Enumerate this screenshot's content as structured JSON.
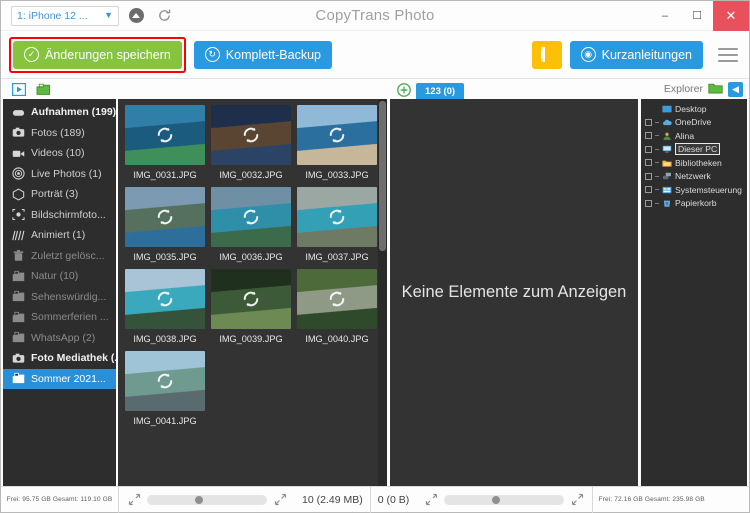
{
  "titlebar": {
    "device_label": "1: iPhone 12 ...",
    "chevron": "⌄",
    "eject_icon": "eject-icon",
    "refresh_icon": "refresh-icon",
    "app_title": "CopyTrans Photo",
    "minimize": "–",
    "maximize": "☐",
    "close": "✕"
  },
  "toolbar": {
    "save_label": "Änderungen speichern",
    "backup_label": "Komplett-Backup",
    "tips_label": "Kurzanleitungen",
    "bulb_icon": "lightbulb-icon",
    "menu_icon": "hamburger-menu-icon",
    "accent_green": "#86c440",
    "accent_blue": "#2a9ae0",
    "accent_yellow": "#fcc006",
    "highlight_red": "#ff0000"
  },
  "sidebar": {
    "tab_video_icon": "video-tab-icon",
    "tab_album_icon": "album-tab-icon",
    "items": [
      {
        "label": "Aufnahmen (199)",
        "icon": "camera-roll-icon",
        "style": "bold"
      },
      {
        "label": "Fotos (189)",
        "icon": "camera-icon",
        "style": "normal"
      },
      {
        "label": "Videos (10)",
        "icon": "video-icon",
        "style": "normal"
      },
      {
        "label": "Live Photos (1)",
        "icon": "live-photo-icon",
        "style": "normal"
      },
      {
        "label": "Porträt (3)",
        "icon": "portrait-icon",
        "style": "normal"
      },
      {
        "label": "Bildschirmfoto...",
        "icon": "screenshot-icon",
        "style": "normal"
      },
      {
        "label": "Animiert (1)",
        "icon": "animated-icon",
        "style": "normal"
      },
      {
        "label": "Zuletzt gelösc...",
        "icon": "trash-icon",
        "style": "dim"
      },
      {
        "label": "Natur (10)",
        "icon": "album-icon",
        "style": "dim"
      },
      {
        "label": "Sehenswürdig...",
        "icon": "album-icon",
        "style": "dim"
      },
      {
        "label": "Sommerferien ...",
        "icon": "album-icon",
        "style": "dim"
      },
      {
        "label": "WhatsApp (2)",
        "icon": "album-icon",
        "style": "dim"
      },
      {
        "label": "Foto Mediathek (...",
        "icon": "camera-icon",
        "style": "bold"
      },
      {
        "label": "Sommer 2021...",
        "icon": "album-icon",
        "style": "selected"
      }
    ]
  },
  "thumbnails": {
    "sync_icon": "sync-refresh-icon",
    "items": [
      {
        "name": "IMG_0031.JPG",
        "c1": "#2f7fa8",
        "c2": "#1b5c7e",
        "c3": "#3f8f5a"
      },
      {
        "name": "IMG_0032.JPG",
        "c1": "#1d2f4a",
        "c2": "#5a4532",
        "c3": "#2b4466"
      },
      {
        "name": "IMG_0033.JPG",
        "c1": "#8fb9d6",
        "c2": "#2a6f9e",
        "c3": "#c7b79a"
      },
      {
        "name": "IMG_0035.JPG",
        "c1": "#7d9ab3",
        "c2": "#55705f",
        "c3": "#2d6e9a"
      },
      {
        "name": "IMG_0036.JPG",
        "c1": "#6f8fa4",
        "c2": "#2f8fa8",
        "c3": "#3b6b4a"
      },
      {
        "name": "IMG_0037.JPG",
        "c1": "#9aa7a3",
        "c2": "#34a0b5",
        "c3": "#6e7a63"
      },
      {
        "name": "IMG_0038.JPG",
        "c1": "#a8c4d6",
        "c2": "#3aa9bd",
        "c3": "#35523a"
      },
      {
        "name": "IMG_0039.JPG",
        "c1": "#20301f",
        "c2": "#3c5a38",
        "c3": "#6d8a55"
      },
      {
        "name": "IMG_0040.JPG",
        "c1": "#4d6b3a",
        "c2": "#8f9a86",
        "c3": "#2f4a2b"
      },
      {
        "name": "IMG_0041.JPG",
        "c1": "#9fc4d8",
        "c2": "#6f9a8f",
        "c3": "#5a6b70"
      }
    ]
  },
  "center": {
    "add_tab_icon": "plus-circle-icon",
    "tab_label": "123 (0)",
    "empty_message": "Keine Elemente zum Anzeigen"
  },
  "explorer": {
    "title": "Explorer",
    "folder_icon": "folder-icon",
    "collapse_icon": "collapse-left-icon",
    "items": [
      {
        "label": "Desktop",
        "icon": "desktop-icon",
        "root": true,
        "framed": false
      },
      {
        "label": "OneDrive",
        "icon": "onedrive-cloud-icon",
        "root": false,
        "framed": false
      },
      {
        "label": "Alina",
        "icon": "user-icon",
        "root": false,
        "framed": false
      },
      {
        "label": "Dieser PC",
        "icon": "computer-icon",
        "root": false,
        "framed": true
      },
      {
        "label": "Bibliotheken",
        "icon": "library-folder-icon",
        "root": false,
        "framed": false
      },
      {
        "label": "Netzwerk",
        "icon": "network-icon",
        "root": false,
        "framed": false
      },
      {
        "label": "Systemsteuerung",
        "icon": "control-panel-icon",
        "root": false,
        "framed": false
      },
      {
        "label": "Papierkorb",
        "icon": "recycle-bin-icon",
        "root": false,
        "framed": false
      }
    ]
  },
  "statusbar": {
    "device_storage": "Frei: 95.75 GB Gesamt: 119.10 GB",
    "pc_storage": "Frei: 72.16 GB Gesamt: 235.98 GB",
    "selected_count": "10 (2.49 MB)",
    "pc_selected_count": "0 (0 B)",
    "zoom_out_icon": "zoom-out-icon",
    "zoom_in_icon": "zoom-in-icon"
  }
}
